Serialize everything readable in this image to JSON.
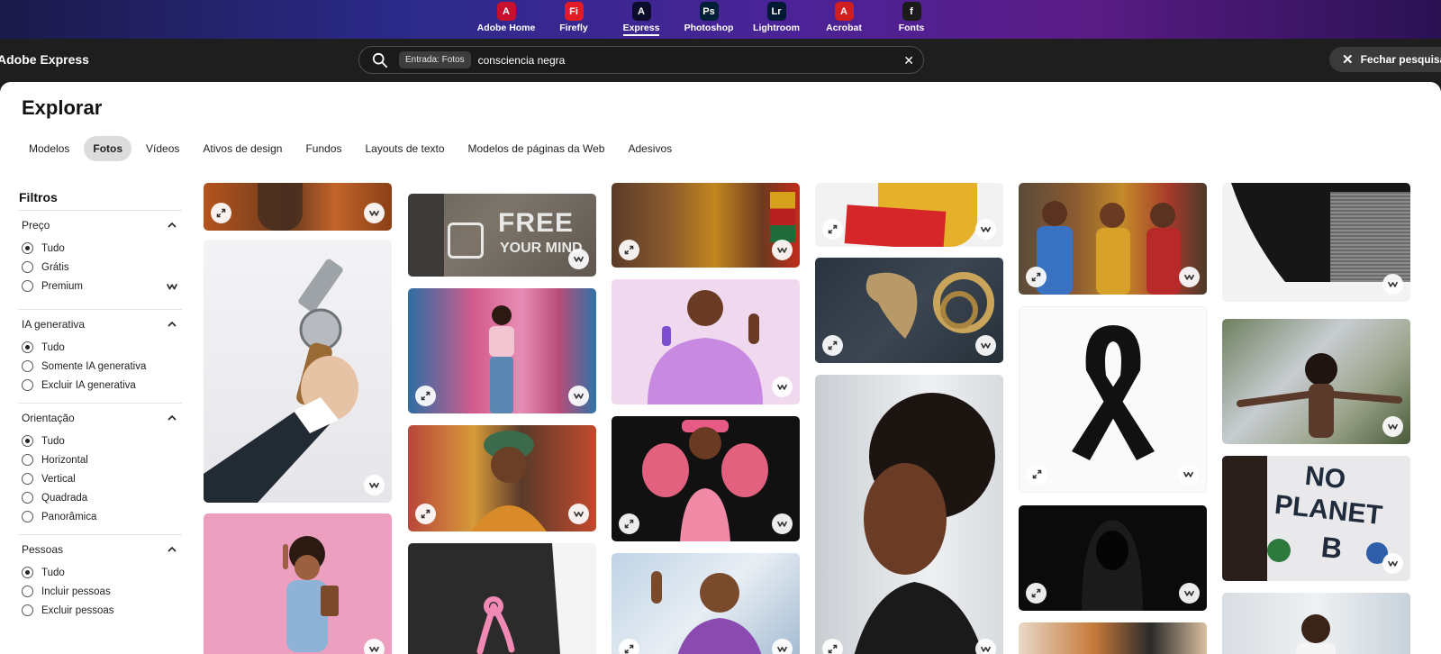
{
  "apps": [
    {
      "label": "Adobe Home",
      "glyph": "A",
      "color": "#c8102e",
      "icon": "adobe-home-icon"
    },
    {
      "label": "Firefly",
      "glyph": "Fi",
      "color": "#e31b23",
      "icon": "firefly-icon"
    },
    {
      "label": "Express",
      "glyph": "A",
      "color": "#0b0b2b",
      "icon": "express-icon",
      "active": true
    },
    {
      "label": "Photoshop",
      "glyph": "Ps",
      "color": "#001e36",
      "icon": "photoshop-icon"
    },
    {
      "label": "Lightroom",
      "glyph": "Lr",
      "color": "#001a33",
      "icon": "lightroom-icon"
    },
    {
      "label": "Acrobat",
      "glyph": "A",
      "color": "#d21e1e",
      "icon": "acrobat-icon"
    },
    {
      "label": "Fonts",
      "glyph": "f",
      "color": "#1b1b1b",
      "icon": "fonts-icon"
    }
  ],
  "header": {
    "brand": "Adobe Express",
    "search_chip": "Entrada: Fotos",
    "search_value": "consciencia negra",
    "close_label": "Fechar pesquisa"
  },
  "main": {
    "title": "Explorar",
    "tabs": [
      {
        "label": "Modelos"
      },
      {
        "label": "Fotos",
        "active": true
      },
      {
        "label": "Vídeos"
      },
      {
        "label": "Ativos de design"
      },
      {
        "label": "Fundos"
      },
      {
        "label": "Layouts de texto"
      },
      {
        "label": "Modelos de páginas da Web"
      },
      {
        "label": "Adesivos"
      }
    ]
  },
  "filters": {
    "title": "Filtros",
    "groups": [
      {
        "name": "Preço",
        "options": [
          "Tudo",
          "Grátis",
          "Premium"
        ],
        "selected": 0
      },
      {
        "name": "IA generativa",
        "options": [
          "Tudo",
          "Somente IA generativa",
          "Excluir IA generativa"
        ],
        "selected": 0
      },
      {
        "name": "Orientação",
        "options": [
          "Tudo",
          "Horizontal",
          "Vertical",
          "Quadrada",
          "Panorâmica"
        ],
        "selected": 0
      },
      {
        "name": "Pessoas",
        "options": [
          "Tudo",
          "Incluir pessoas",
          "Excluir pessoas"
        ],
        "selected": 0
      }
    ]
  },
  "photos": {
    "free_your_mind": [
      "FREE",
      "YOUR MIND"
    ],
    "no_planet_b": [
      "NO",
      "PLANET",
      "B"
    ]
  },
  "colors": {
    "badge_icon": "#333333"
  }
}
